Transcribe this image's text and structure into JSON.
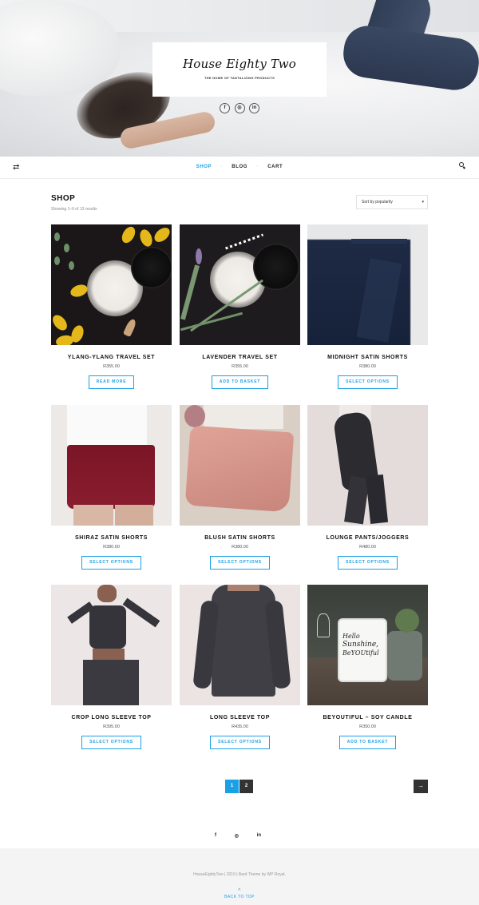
{
  "site": {
    "title": "House Eighty Two",
    "tagline": "THE HOME OF TANTALIZING PRODUCTS",
    "social": [
      "f",
      "◎",
      "in"
    ]
  },
  "nav": {
    "items": [
      {
        "label": "SHOP",
        "active": true
      },
      {
        "label": "BLOG",
        "active": false
      },
      {
        "label": "CART",
        "active": false
      }
    ],
    "separator": "·",
    "accent": "#1aa0e6"
  },
  "shop": {
    "title": "SHOP",
    "result_count": "Showing 1–9 of 13 results",
    "sort_value": "Sort by popularity"
  },
  "products": [
    {
      "name": "YLANG-YLANG TRAVEL SET",
      "price": "R355.00",
      "button": "READ MORE"
    },
    {
      "name": "LAVENDER TRAVEL SET",
      "price": "R355.00",
      "button": "ADD TO BASKET"
    },
    {
      "name": "MIDNIGHT SATIN SHORTS",
      "price": "R380.00",
      "button": "SELECT OPTIONS"
    },
    {
      "name": "SHIRAZ SATIN SHORTS",
      "price": "R380.00",
      "button": "SELECT OPTIONS"
    },
    {
      "name": "BLUSH SATIN SHORTS",
      "price": "R380.00",
      "button": "SELECT OPTIONS"
    },
    {
      "name": "LOUNGE PANTS/JOGGERS",
      "price": "R480.00",
      "button": "SELECT OPTIONS"
    },
    {
      "name": "CROP LONG SLEEVE TOP",
      "price": "R395.00",
      "button": "SELECT OPTIONS"
    },
    {
      "name": "LONG SLEEVE TOP",
      "price": "R435.00",
      "button": "SELECT OPTIONS"
    },
    {
      "name": "BEYOUTIFUL – SOY CANDLE",
      "price": "R350.00",
      "button": "ADD TO BASKET"
    }
  ],
  "candle_label": {
    "line1": "Hello",
    "line2": "Sunshine,",
    "line3": "BeYOUtiful"
  },
  "pagination": {
    "pages": [
      "1",
      "2"
    ],
    "current": "1",
    "next": "→"
  },
  "footer": {
    "social": [
      "f",
      "◎",
      "in"
    ],
    "copyright": "HouseEightyTwo | 2019 | Bard Theme by WP Royal.",
    "back_to_top": "BACK TO TOP",
    "back_to_top_arrow": "^"
  }
}
